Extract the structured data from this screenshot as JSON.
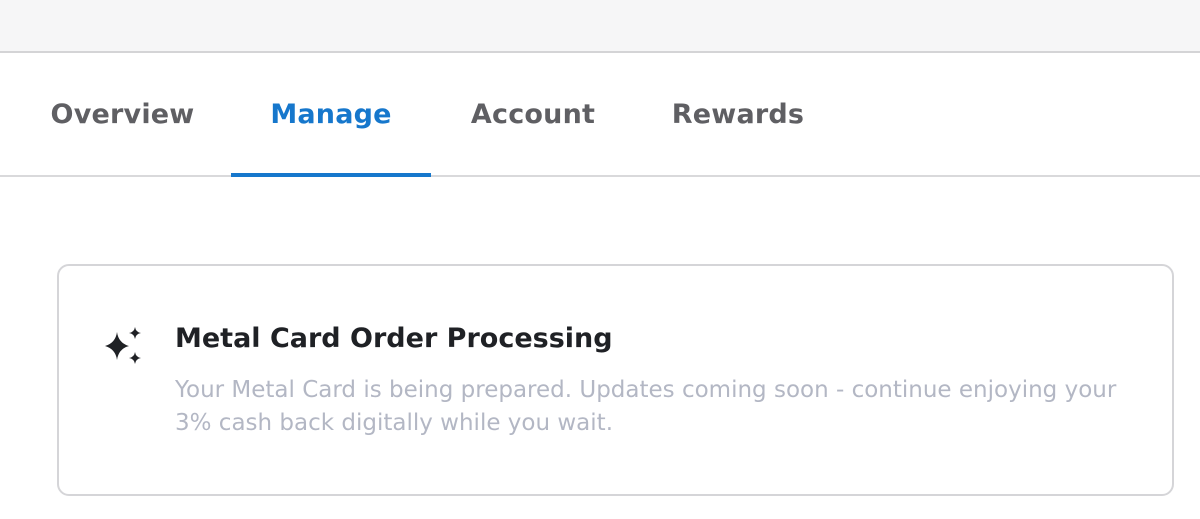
{
  "tabs": [
    {
      "label": "Overview",
      "active": false
    },
    {
      "label": "Manage",
      "active": true
    },
    {
      "label": "Account",
      "active": false
    },
    {
      "label": "Rewards",
      "active": false
    }
  ],
  "card": {
    "icon": "sparkles-icon",
    "title": "Metal Card Order Processing",
    "body": "Your Metal Card is being prepared. Updates coming soon - continue enjoying your 3% cash back digitally while you wait."
  },
  "colors": {
    "accent": "#1677cc",
    "tab_inactive": "#5f5f63",
    "title_text": "#1f2125",
    "body_text": "#b3b7c4",
    "border": "#d5d5d8"
  }
}
